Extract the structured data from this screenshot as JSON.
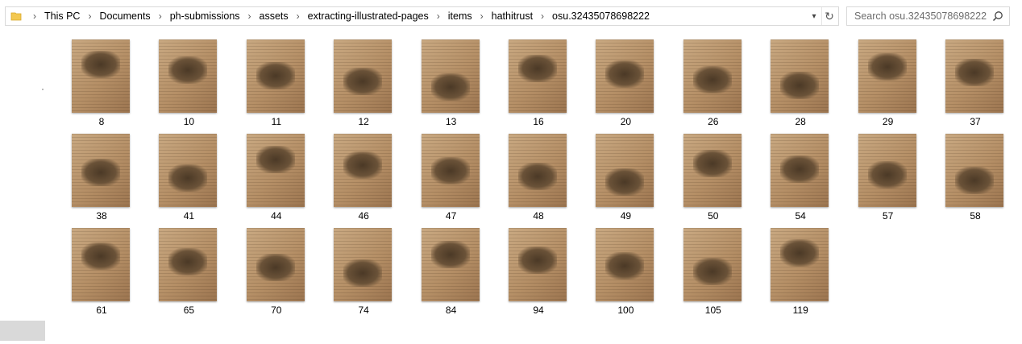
{
  "address_bar": {
    "breadcrumbs": [
      "This PC",
      "Documents",
      "ph-submissions",
      "assets",
      "extracting-illustrated-pages",
      "items",
      "hathitrust",
      "osu.32435078698222"
    ]
  },
  "search": {
    "placeholder": "Search osu.32435078698222"
  },
  "files": [
    {
      "name": "8"
    },
    {
      "name": "10"
    },
    {
      "name": "11"
    },
    {
      "name": "12"
    },
    {
      "name": "13"
    },
    {
      "name": "16"
    },
    {
      "name": "20"
    },
    {
      "name": "26"
    },
    {
      "name": "28"
    },
    {
      "name": "29"
    },
    {
      "name": "37"
    },
    {
      "name": "38"
    },
    {
      "name": "41"
    },
    {
      "name": "44"
    },
    {
      "name": "46"
    },
    {
      "name": "47"
    },
    {
      "name": "48"
    },
    {
      "name": "49"
    },
    {
      "name": "50"
    },
    {
      "name": "54"
    },
    {
      "name": "57"
    },
    {
      "name": "58"
    },
    {
      "name": "61"
    },
    {
      "name": "65"
    },
    {
      "name": "70"
    },
    {
      "name": "74"
    },
    {
      "name": "84"
    },
    {
      "name": "94"
    },
    {
      "name": "100"
    },
    {
      "name": "105"
    },
    {
      "name": "119"
    }
  ]
}
